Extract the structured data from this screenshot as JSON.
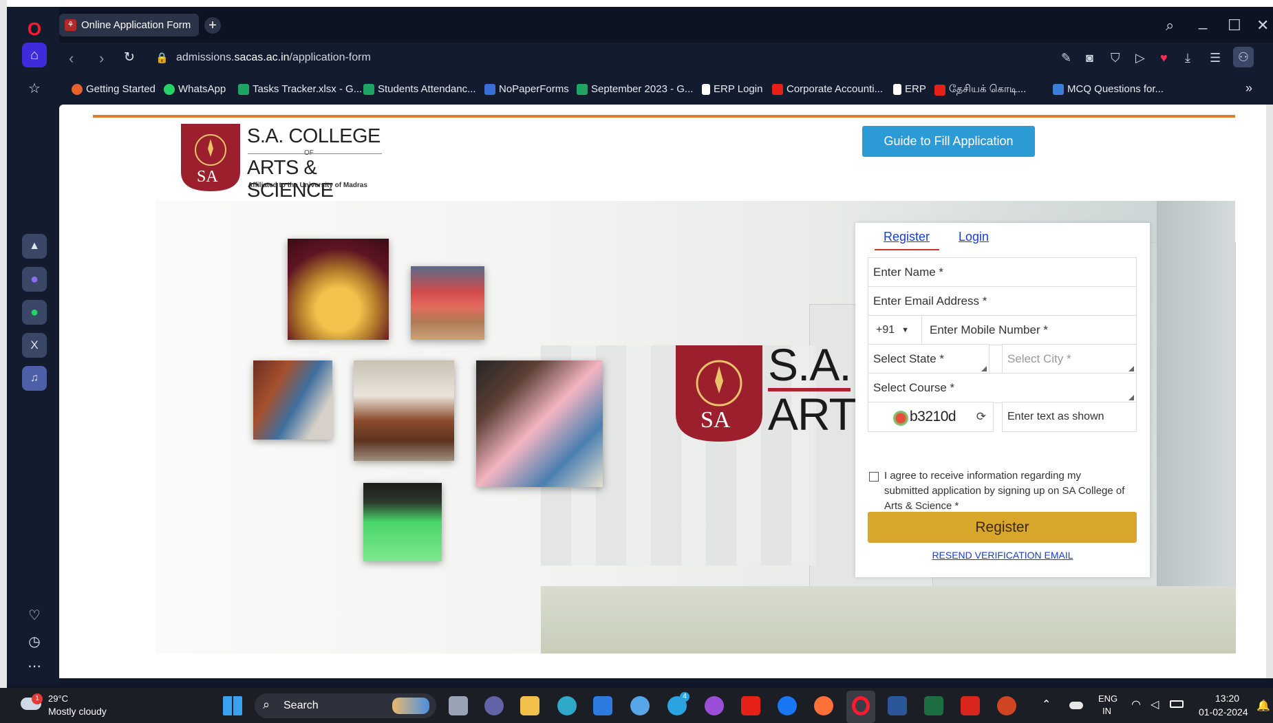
{
  "browser": {
    "tab_title": "Online Application Form",
    "url_prefix": "admissions.",
    "url_domain": "sacas.ac.in",
    "url_path": "/application-form"
  },
  "bookmarks": [
    {
      "label": "Getting Started",
      "color": "#e8632b"
    },
    {
      "label": "WhatsApp",
      "color": "#25d366"
    },
    {
      "label": "Tasks Tracker.xlsx - G...",
      "color": "#1fa463"
    },
    {
      "label": "Students Attendanc...",
      "color": "#1fa463"
    },
    {
      "label": "NoPaperForms",
      "color": "#3b6fd6"
    },
    {
      "label": "September 2023 - G...",
      "color": "#1fa463"
    },
    {
      "label": "ERP Login",
      "color": "#ffffff"
    },
    {
      "label": "Corporate Accounti...",
      "color": "#e62117"
    },
    {
      "label": "ERP",
      "color": "#ffffff"
    },
    {
      "label": "தேசியக் கொடி...",
      "color": "#e62117"
    },
    {
      "label": "MCQ Questions for...",
      "color": "#3b7dd8"
    }
  ],
  "page": {
    "logo_line1": "S.A. COLLEGE",
    "logo_of": "OF",
    "logo_line2": "ARTS & SCIENCE",
    "logo_tag": "Affiliated to the University of Madras",
    "logo_mark": "SA",
    "guide_button": "Guide to Fill Application",
    "hero_sign_1": "S.A.",
    "hero_sign_2": "ARTS"
  },
  "form": {
    "tab_register": "Register",
    "tab_login": "Login",
    "name_placeholder": "Enter Name *",
    "email_placeholder": "Enter Email Address *",
    "country_code": "+91",
    "mobile_placeholder": "Enter Mobile Number *",
    "state_label": "Select State *",
    "city_label": "Select City *",
    "course_label": "Select Course *",
    "captcha": "b3210d",
    "captcha_placeholder": "Enter text as shown",
    "agree_text": "I agree to receive information regarding my submitted application by signing up on SA College of Arts & Science *",
    "register_button": "Register",
    "resend_link": "RESEND VERIFICATION EMAIL"
  },
  "taskbar": {
    "temperature": "29°C",
    "weather": "Mostly cloudy",
    "weather_badge": "1",
    "search": "Search",
    "lang_1": "ENG",
    "lang_2": "IN",
    "time": "13:20",
    "date": "01-02-2024",
    "telegram_badge": "4"
  }
}
